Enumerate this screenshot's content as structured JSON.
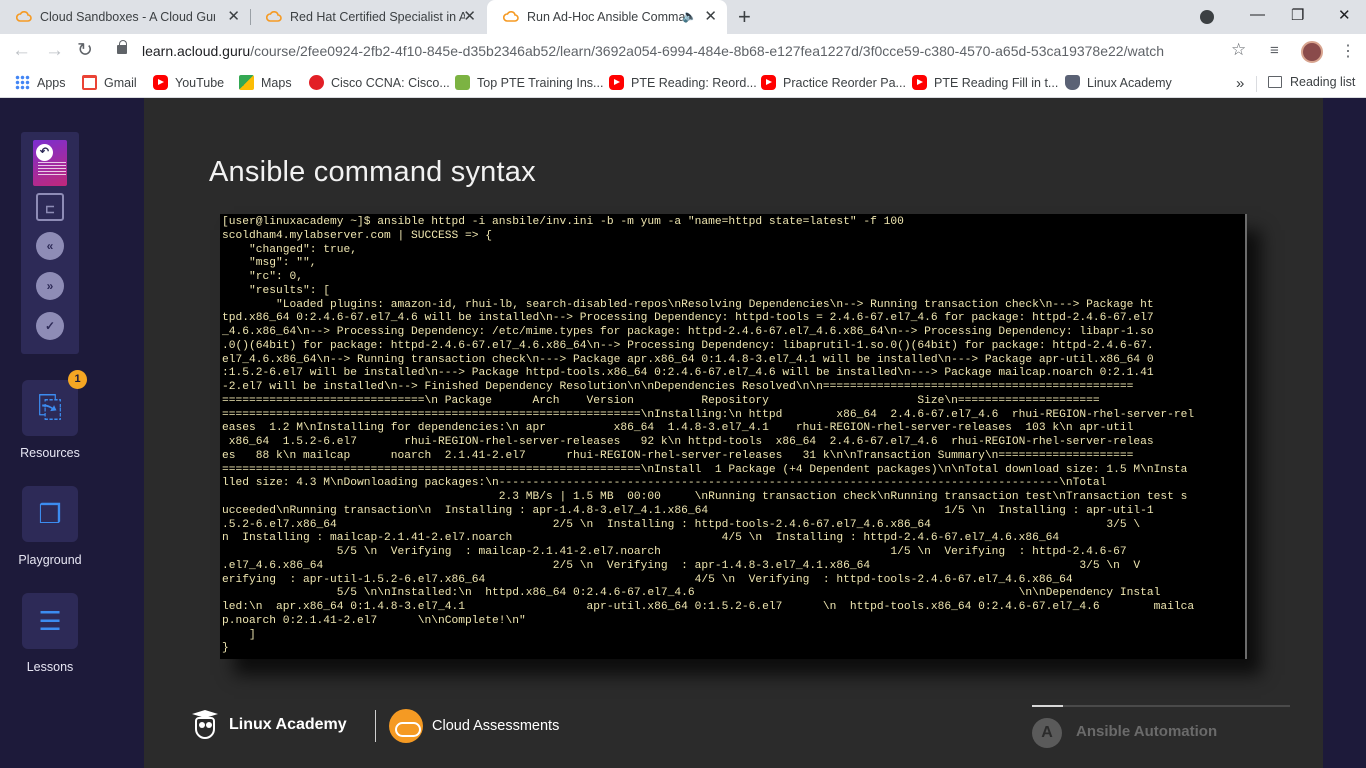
{
  "browser": {
    "tabs": [
      {
        "title": "Cloud Sandboxes - A Cloud Guru",
        "close": "✕",
        "favicon": "acg-cloud-icon",
        "active": false
      },
      {
        "title": "Red Hat Certified Specialist in An",
        "close": "✕",
        "favicon": "acg-cloud-icon",
        "active": false
      },
      {
        "title": "Run Ad-Hoc Ansible Comma",
        "close": "✕",
        "favicon": "acg-cloud-icon",
        "active": true,
        "audio": "🔈"
      }
    ],
    "new_tab": "+",
    "window_controls": {
      "minimize": "—",
      "maximize": "❐",
      "close": "✕"
    },
    "url_host": "learn.acloud.guru",
    "url_path": "/course/2fee0924-2fb2-4f10-845e-d35b2346ab52/learn/3692a054-6994-484e-8b68-e127fea1227d/3f0cce59-c380-4570-a65d-53ca19378e22/watch",
    "nav": {
      "back": "←",
      "forward": "→",
      "reload": "↻"
    },
    "star": "☆",
    "kebab": "⋮",
    "bookmarks": [
      {
        "label": "Apps",
        "icon": "apps-icon"
      },
      {
        "label": "Gmail",
        "icon": "gmail-icon"
      },
      {
        "label": "YouTube",
        "icon": "youtube-icon"
      },
      {
        "label": "Maps",
        "icon": "maps-icon"
      },
      {
        "label": "Cisco CCNA: Cisco...",
        "icon": "cisco-icon"
      },
      {
        "label": "Top PTE Training Ins...",
        "icon": "pte-icon"
      },
      {
        "label": "PTE Reading: Reord...",
        "icon": "youtube-icon"
      },
      {
        "label": "Practice Reorder Pa...",
        "icon": "youtube-icon"
      },
      {
        "label": "PTE Reading Fill in t...",
        "icon": "youtube-icon"
      },
      {
        "label": "Linux Academy",
        "icon": "linux-academy-icon"
      }
    ],
    "bookmarks_more": "»",
    "reading_list": "Reading list"
  },
  "rail": {
    "back_glyph": "↶",
    "resources": {
      "label": "Resources",
      "badge": "1",
      "glyph": "⎘"
    },
    "playground": {
      "label": "Playground",
      "glyph": "❒"
    },
    "lessons": {
      "label": "Lessons",
      "glyph": "☰"
    },
    "controls": {
      "sidebar": "⊏",
      "rewind": "«",
      "forward": "»",
      "complete": "✓"
    }
  },
  "slide": {
    "title": "Ansible command syntax",
    "terminal_lines": [
      "[user@linuxacademy ~]$ ansible httpd -i ansbile/inv.ini -b -m yum -a \"name=httpd state=latest\" -f 100",
      "scoldham4.mylabserver.com | SUCCESS => {",
      "    \"changed\": true,",
      "    \"msg\": \"\",",
      "    \"rc\": 0,",
      "    \"results\": [",
      "        \"Loaded plugins: amazon-id, rhui-lb, search-disabled-repos\\nResolving Dependencies\\n--> Running transaction check\\n---> Package ht",
      "tpd.x86_64 0:2.4.6-67.el7_4.6 will be installed\\n--> Processing Dependency: httpd-tools = 2.4.6-67.el7_4.6 for package: httpd-2.4.6-67.el7",
      "_4.6.x86_64\\n--> Processing Dependency: /etc/mime.types for package: httpd-2.4.6-67.el7_4.6.x86_64\\n--> Processing Dependency: libapr-1.so",
      ".0()(64bit) for package: httpd-2.4.6-67.el7_4.6.x86_64\\n--> Processing Dependency: libaprutil-1.so.0()(64bit) for package: httpd-2.4.6-67.",
      "el7_4.6.x86_64\\n--> Running transaction check\\n---> Package apr.x86_64 0:1.4.8-3.el7_4.1 will be installed\\n---> Package apr-util.x86_64 0",
      ":1.5.2-6.el7 will be installed\\n---> Package httpd-tools.x86_64 0:2.4.6-67.el7_4.6 will be installed\\n---> Package mailcap.noarch 0:2.1.41",
      "-2.el7 will be installed\\n--> Finished Dependency Resolution\\n\\nDependencies Resolved\\n\\n==============================================",
      "==============================\\n Package      Arch    Version          Repository                      Size\\n=====================",
      "==============================================================\\nInstalling:\\n httpd        x86_64  2.4.6-67.el7_4.6  rhui-REGION-rhel-server-rel",
      "eases  1.2 M\\nInstalling for dependencies:\\n apr          x86_64  1.4.8-3.el7_4.1    rhui-REGION-rhel-server-releases  103 k\\n apr-util",
      " x86_64  1.5.2-6.el7       rhui-REGION-rhel-server-releases   92 k\\n httpd-tools  x86_64  2.4.6-67.el7_4.6  rhui-REGION-rhel-server-releas",
      "es   88 k\\n mailcap      noarch  2.1.41-2.el7      rhui-REGION-rhel-server-releases   31 k\\n\\nTransaction Summary\\n====================",
      "==============================================================\\nInstall  1 Package (+4 Dependent packages)\\n\\nTotal download size: 1.5 M\\nInsta",
      "lled size: 4.3 M\\nDownloading packages:\\n-----------------------------------------------------------------------------------\\nTotal",
      "                                         2.3 MB/s | 1.5 MB  00:00     \\nRunning transaction check\\nRunning transaction test\\nTransaction test s",
      "ucceeded\\nRunning transaction\\n  Installing : apr-1.4.8-3.el7_4.1.x86_64                                   1/5 \\n  Installing : apr-util-1",
      ".5.2-6.el7.x86_64                                2/5 \\n  Installing : httpd-tools-2.4.6-67.el7_4.6.x86_64                          3/5 \\",
      "n  Installing : mailcap-2.1.41-2.el7.noarch                               4/5 \\n  Installing : httpd-2.4.6-67.el7_4.6.x86_64",
      "                 5/5 \\n  Verifying  : mailcap-2.1.41-2.el7.noarch                                  1/5 \\n  Verifying  : httpd-2.4.6-67",
      ".el7_4.6.x86_64                                  2/5 \\n  Verifying  : apr-1.4.8-3.el7_4.1.x86_64                               3/5 \\n  V",
      "erifying  : apr-util-1.5.2-6.el7.x86_64                               4/5 \\n  Verifying  : httpd-tools-2.4.6-67.el7_4.6.x86_64",
      "                 5/5 \\n\\nInstalled:\\n  httpd.x86_64 0:2.4.6-67.el7_4.6                                                \\n\\nDependency Instal",
      "led:\\n  apr.x86_64 0:1.4.8-3.el7_4.1                  apr-util.x86_64 0:1.5.2-6.el7      \\n  httpd-tools.x86_64 0:2.4.6-67.el7_4.6        mailca",
      "p.noarch 0:2.1.41-2.el7      \\n\\nComplete!\\n\"",
      "    ]",
      "}"
    ],
    "footer": {
      "linux_academy": "Linux Academy",
      "cloud_assessments": "Cloud Assessments",
      "ansible": "Ansible Automation",
      "ansible_glyph": "A",
      "progress_fraction": 0.12
    }
  }
}
